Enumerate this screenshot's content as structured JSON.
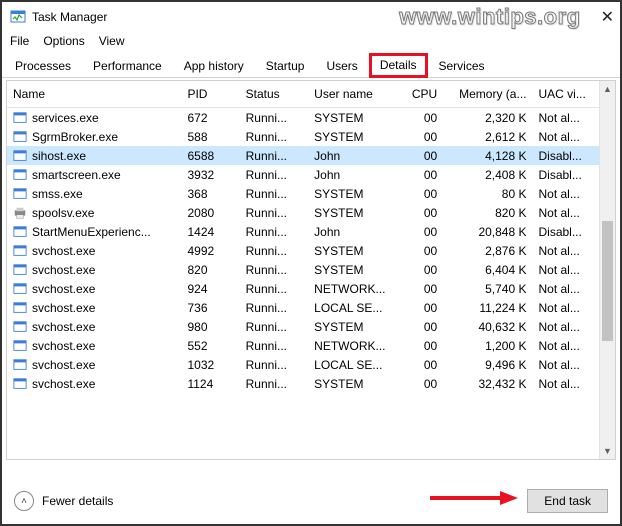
{
  "window": {
    "title": "Task Manager",
    "watermark": "www.wintips.org"
  },
  "menu": {
    "file": "File",
    "options": "Options",
    "view": "View"
  },
  "tabs": {
    "processes": "Processes",
    "performance": "Performance",
    "apphistory": "App history",
    "startup": "Startup",
    "users": "Users",
    "details": "Details",
    "services": "Services"
  },
  "columns": {
    "name": "Name",
    "pid": "PID",
    "status": "Status",
    "user": "User name",
    "cpu": "CPU",
    "memory": "Memory (a...",
    "uac": "UAC vi..."
  },
  "rows": [
    {
      "icon": "exe",
      "name": "services.exe",
      "pid": "672",
      "status": "Runni...",
      "user": "SYSTEM",
      "cpu": "00",
      "mem": "2,320 K",
      "uac": "Not al...",
      "sel": false
    },
    {
      "icon": "exe",
      "name": "SgrmBroker.exe",
      "pid": "588",
      "status": "Runni...",
      "user": "SYSTEM",
      "cpu": "00",
      "mem": "2,612 K",
      "uac": "Not al...",
      "sel": false
    },
    {
      "icon": "exe",
      "name": "sihost.exe",
      "pid": "6588",
      "status": "Runni...",
      "user": "John",
      "cpu": "00",
      "mem": "4,128 K",
      "uac": "Disabl...",
      "sel": true
    },
    {
      "icon": "exe",
      "name": "smartscreen.exe",
      "pid": "3932",
      "status": "Runni...",
      "user": "John",
      "cpu": "00",
      "mem": "2,408 K",
      "uac": "Disabl...",
      "sel": false
    },
    {
      "icon": "exe",
      "name": "smss.exe",
      "pid": "368",
      "status": "Runni...",
      "user": "SYSTEM",
      "cpu": "00",
      "mem": "80 K",
      "uac": "Not al...",
      "sel": false
    },
    {
      "icon": "print",
      "name": "spoolsv.exe",
      "pid": "2080",
      "status": "Runni...",
      "user": "SYSTEM",
      "cpu": "00",
      "mem": "820 K",
      "uac": "Not al...",
      "sel": false
    },
    {
      "icon": "exe",
      "name": "StartMenuExperienc...",
      "pid": "1424",
      "status": "Runni...",
      "user": "John",
      "cpu": "00",
      "mem": "20,848 K",
      "uac": "Disabl...",
      "sel": false
    },
    {
      "icon": "exe",
      "name": "svchost.exe",
      "pid": "4992",
      "status": "Runni...",
      "user": "SYSTEM",
      "cpu": "00",
      "mem": "2,876 K",
      "uac": "Not al...",
      "sel": false
    },
    {
      "icon": "exe",
      "name": "svchost.exe",
      "pid": "820",
      "status": "Runni...",
      "user": "SYSTEM",
      "cpu": "00",
      "mem": "6,404 K",
      "uac": "Not al...",
      "sel": false
    },
    {
      "icon": "exe",
      "name": "svchost.exe",
      "pid": "924",
      "status": "Runni...",
      "user": "NETWORK...",
      "cpu": "00",
      "mem": "5,740 K",
      "uac": "Not al...",
      "sel": false
    },
    {
      "icon": "exe",
      "name": "svchost.exe",
      "pid": "736",
      "status": "Runni...",
      "user": "LOCAL SE...",
      "cpu": "00",
      "mem": "11,224 K",
      "uac": "Not al...",
      "sel": false
    },
    {
      "icon": "exe",
      "name": "svchost.exe",
      "pid": "980",
      "status": "Runni...",
      "user": "SYSTEM",
      "cpu": "00",
      "mem": "40,632 K",
      "uac": "Not al...",
      "sel": false
    },
    {
      "icon": "exe",
      "name": "svchost.exe",
      "pid": "552",
      "status": "Runni...",
      "user": "NETWORK...",
      "cpu": "00",
      "mem": "1,200 K",
      "uac": "Not al...",
      "sel": false
    },
    {
      "icon": "exe",
      "name": "svchost.exe",
      "pid": "1032",
      "status": "Runni...",
      "user": "LOCAL SE...",
      "cpu": "00",
      "mem": "9,496 K",
      "uac": "Not al...",
      "sel": false
    },
    {
      "icon": "exe",
      "name": "svchost.exe",
      "pid": "1124",
      "status": "Runni...",
      "user": "SYSTEM",
      "cpu": "00",
      "mem": "32,432 K",
      "uac": "Not al...",
      "sel": false
    }
  ],
  "footer": {
    "fewer": "Fewer details",
    "endtask": "End task"
  }
}
